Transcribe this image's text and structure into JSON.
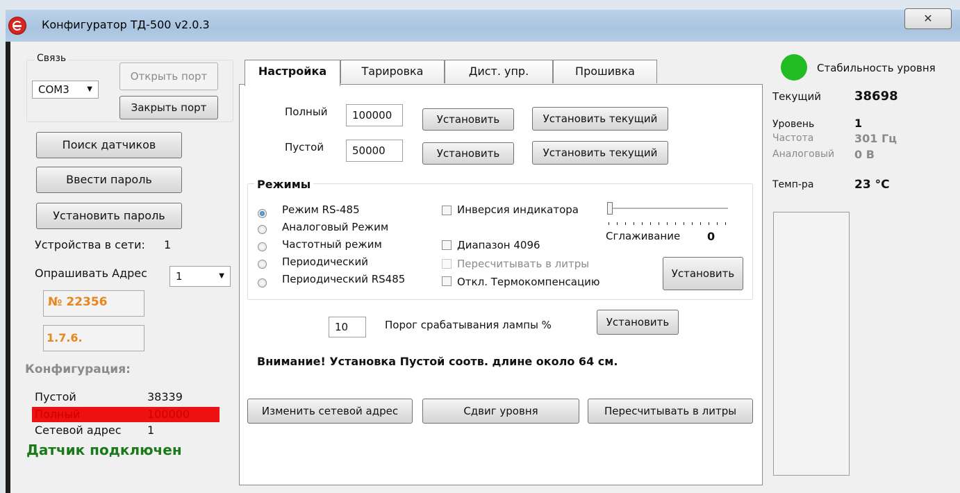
{
  "window": {
    "title": "Конфигуратор ТД-500 v2.0.3",
    "close_glyph": "✕"
  },
  "left": {
    "connection": {
      "group_label": "Связь",
      "port_value": "COM3",
      "open_port": "Открыть порт",
      "close_port": "Закрыть порт"
    },
    "search_sensors": "Поиск датчиков",
    "enter_password": "Ввести пароль",
    "set_password": "Установить пароль",
    "devices_label": "Устройства в сети:",
    "devices_count": "1",
    "poll_label": "Опрашивать Адрес",
    "poll_value": "1",
    "serial": "№ 22356",
    "version": "1.7.6.",
    "config": {
      "heading": "Конфигурация:",
      "rows": [
        {
          "label": "Пустой",
          "value": "38339"
        },
        {
          "label": "Полный",
          "value": "100000"
        },
        {
          "label": "Сетевой адрес",
          "value": "1"
        }
      ]
    },
    "status": "Датчик подключен"
  },
  "tabs": [
    "Настройка",
    "Тарировка",
    "Дист. упр.",
    "Прошивка"
  ],
  "settings": {
    "full_label": "Полный",
    "full_value": "100000",
    "empty_label": "Пустой",
    "empty_value": "50000",
    "set": "Установить",
    "set_current": "Установить текущий",
    "modes": {
      "heading": "Режимы",
      "radio": [
        "Режим RS-485",
        "Аналоговый Режим",
        "Частотный режим",
        "Периодический",
        "Периодический RS485"
      ],
      "selected_index": 0,
      "checks": [
        "Инверсия индикатора",
        "Диапазон 4096",
        "Пересчитывать в литры",
        "Откл. Термокомпенсацию"
      ],
      "smoothing_label": "Сглаживание",
      "smoothing_value": "0",
      "set": "Установить"
    },
    "threshold_value": "10",
    "threshold_label": "Порог срабатывания лампы %",
    "threshold_set": "Установить",
    "warning": "Внимание! Установка Пустой соотв. длине около 64 см.",
    "change_address": "Изменить сетевой адрес",
    "level_shift": "Сдвиг уровня",
    "recalc_liters": "Пересчитывать в литры"
  },
  "right": {
    "stability_label": "Стабильность уровня",
    "stability_color": "#22bb22",
    "current_label": "Текущий",
    "current_value": "38698",
    "level_label": "Уровень",
    "level_value": "1",
    "freq_label": "Частота",
    "freq_value": "301 Гц",
    "analog_label": "Аналоговый",
    "analog_value": "0 В",
    "temp_label": "Темп-ра",
    "temp_value": "23 °C"
  },
  "colors": {
    "serial_orange": "#e8861e",
    "status_green": "#1a7a1a",
    "highlight_red": "#ee1111"
  }
}
